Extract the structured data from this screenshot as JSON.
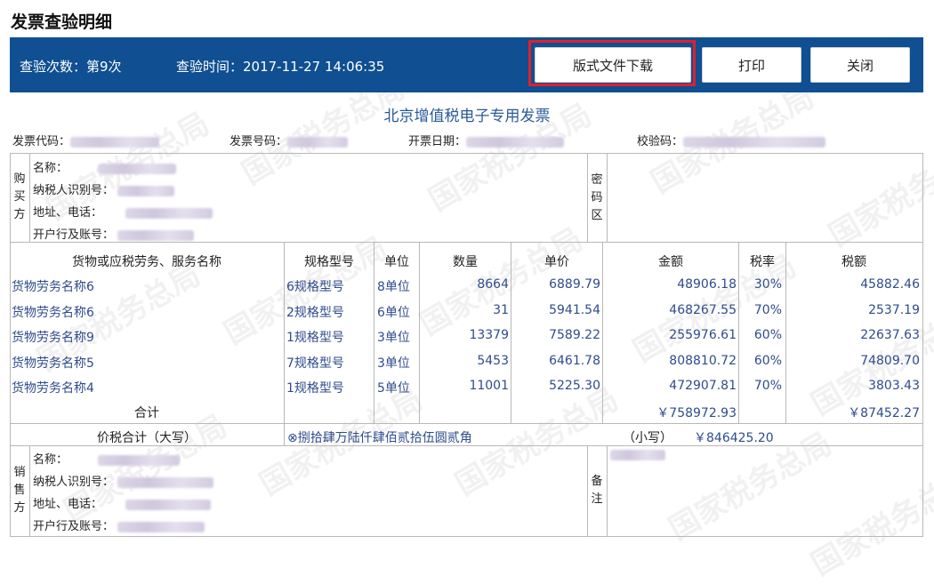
{
  "page": {
    "title": "发票查验明细"
  },
  "toolbar": {
    "check_count_label": "查验次数：第9次",
    "check_time_label": "查验时间：2017-11-27 14:06:35",
    "download_label": "版式文件下载",
    "print_label": "打印",
    "close_label": "关闭"
  },
  "invoice": {
    "title": "北京增值税电子专用发票",
    "meta": {
      "code_label": "发票代码：",
      "number_label": "发票号码：",
      "date_label": "开票日期：",
      "check_code_label": "校验码："
    },
    "buyer": {
      "section_label": "购买方",
      "name_label": "名称：",
      "tax_id_label": "纳税人识别号：",
      "address_label": "地址、电话：",
      "bank_label": "开户行及账号："
    },
    "cipher_label": "密码区",
    "table": {
      "headers": [
        "货物或应税劳务、服务名称",
        "规格型号",
        "单位",
        "数量",
        "单价",
        "金额",
        "税率",
        "税额"
      ],
      "rows": [
        [
          "货物劳务名称6",
          "6规格型号",
          "8单位",
          "8664",
          "6889.79",
          "48906.18",
          "30%",
          "45882.46"
        ],
        [
          "货物劳务名称6",
          "2规格型号",
          "6单位",
          "31",
          "5941.54",
          "468267.55",
          "70%",
          "2537.19"
        ],
        [
          "货物劳务名称9",
          "1规格型号",
          "3单位",
          "13379",
          "7589.22",
          "255976.61",
          "60%",
          "22637.63"
        ],
        [
          "货物劳务名称5",
          "7规格型号",
          "3单位",
          "5453",
          "6461.78",
          "808810.72",
          "60%",
          "74809.70"
        ],
        [
          "货物劳务名称4",
          "1规格型号",
          "5单位",
          "11001",
          "5225.30",
          "472907.81",
          "70%",
          "3803.43"
        ]
      ],
      "total_label": "合计",
      "total_amount": "￥758972.93",
      "total_tax": "￥87452.27"
    },
    "total_in_words": {
      "label": "价税合计（大写）",
      "value": "⊗捌拾肆万陆仟肆佰贰拾伍圆贰角",
      "small_label": "（小写）",
      "small_value": "￥846425.20"
    },
    "seller": {
      "section_label": "销售方",
      "name_label": "名称：",
      "tax_id_label": "纳税人识别号：",
      "address_label": "地址、电话：",
      "bank_label": "开户行及账号："
    },
    "remarks_label": "备注"
  },
  "watermark": "国家税务总局",
  "colors": {
    "header_bg": "#0f4f92",
    "highlight": "#e0202a",
    "cell_text": "#2e4c8c"
  }
}
